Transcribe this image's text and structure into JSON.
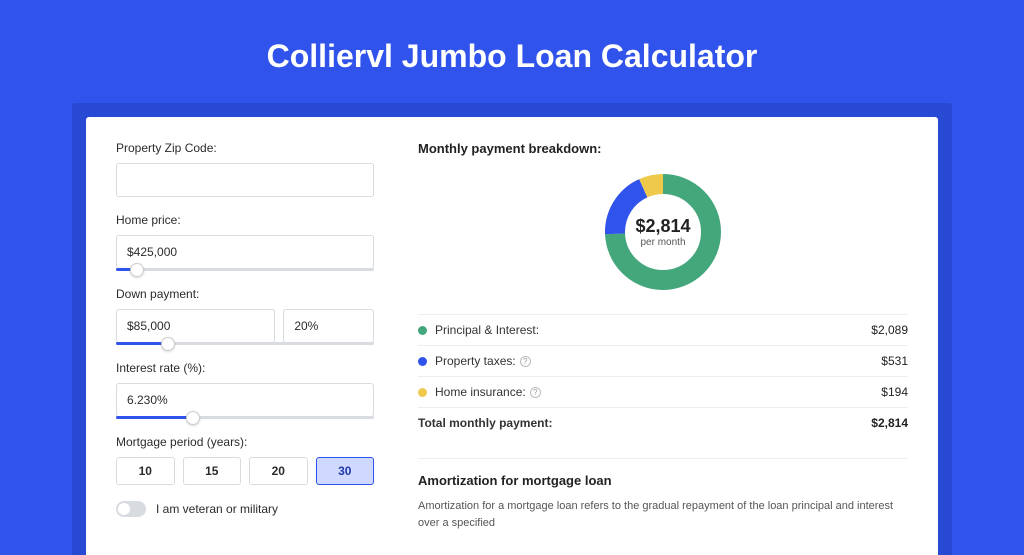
{
  "title": "Colliervl Jumbo Loan Calculator",
  "form": {
    "zip": {
      "label": "Property Zip Code:",
      "value": ""
    },
    "home_price": {
      "label": "Home price:",
      "value": "$425,000",
      "slider_pct": 8
    },
    "down_payment": {
      "label": "Down payment:",
      "amount": "$85,000",
      "percent": "20%",
      "slider_pct": 20
    },
    "interest": {
      "label": "Interest rate (%):",
      "value": "6.230%",
      "slider_pct": 30
    },
    "period": {
      "label": "Mortgage period (years):",
      "options": [
        "10",
        "15",
        "20",
        "30"
      ],
      "selected": "30"
    },
    "veteran": {
      "label": "I am veteran or military",
      "on": false
    }
  },
  "breakdown": {
    "title": "Monthly payment breakdown:",
    "center_value": "$2,814",
    "center_sub": "per month",
    "items": [
      {
        "label": "Principal & Interest:",
        "amount": "$2,089",
        "color": "#44a77c",
        "info": false
      },
      {
        "label": "Property taxes:",
        "amount": "$531",
        "color": "#3053eb",
        "info": true
      },
      {
        "label": "Home insurance:",
        "amount": "$194",
        "color": "#efc94c",
        "info": true
      }
    ],
    "total": {
      "label": "Total monthly payment:",
      "amount": "$2,814"
    }
  },
  "amortization": {
    "title": "Amortization for mortgage loan",
    "text": "Amortization for a mortgage loan refers to the gradual repayment of the loan principal and interest over a specified"
  },
  "chart_data": {
    "type": "pie",
    "title": "Monthly payment breakdown",
    "series": [
      {
        "name": "Principal & Interest",
        "value": 2089,
        "color": "#44a77c"
      },
      {
        "name": "Property taxes",
        "value": 531,
        "color": "#3053eb"
      },
      {
        "name": "Home insurance",
        "value": 194,
        "color": "#efc94c"
      }
    ],
    "total": 2814,
    "center_label": "$2,814 per month"
  }
}
